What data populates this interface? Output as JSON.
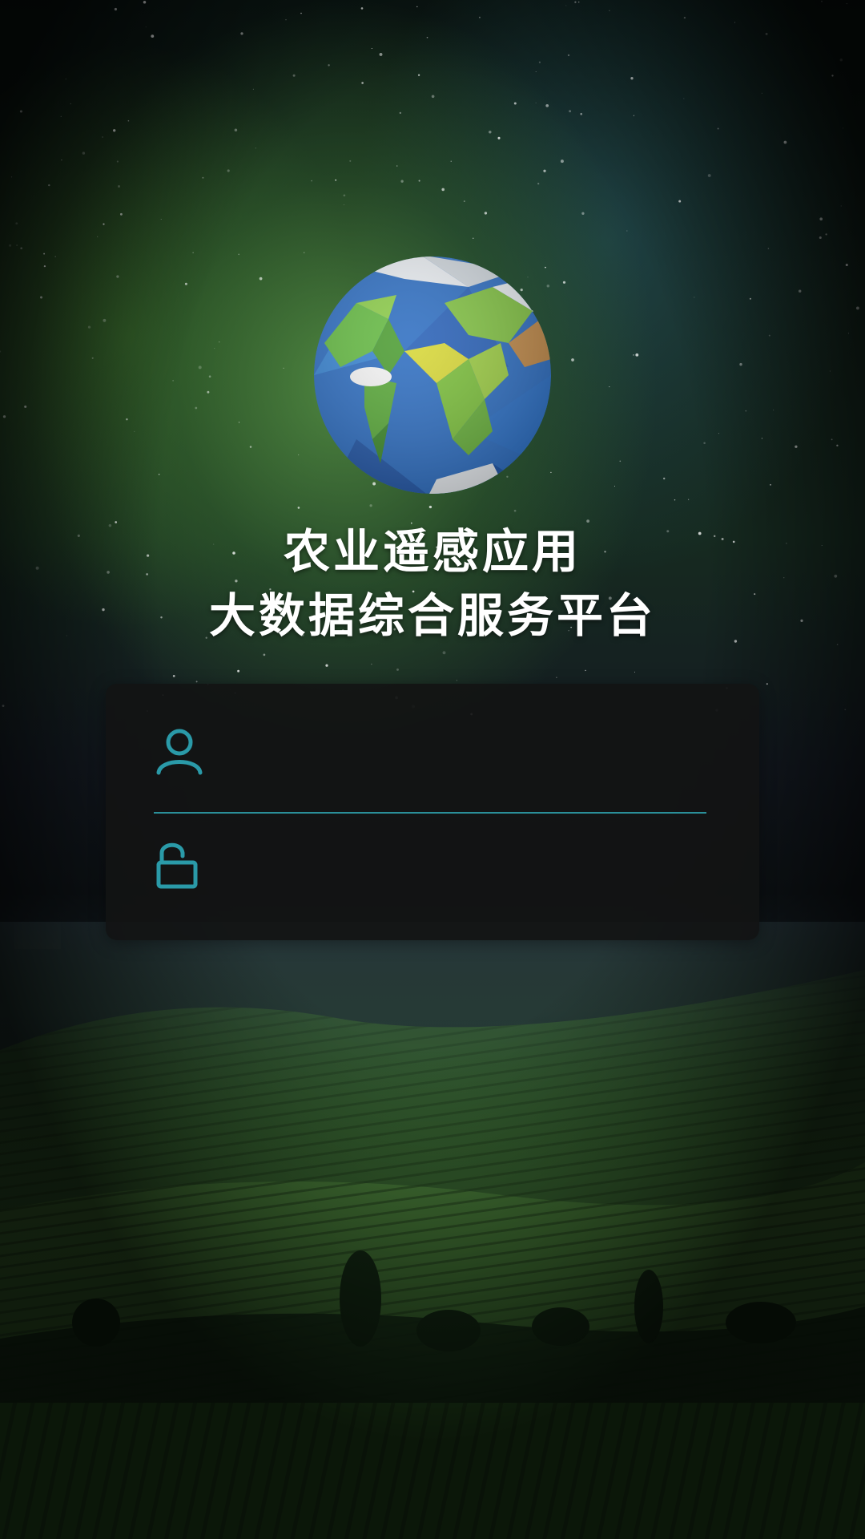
{
  "app": {
    "title_line1": "农业遥感应用",
    "title_line2": "大数据综合服务平台"
  },
  "login": {
    "username": {
      "icon": "user-icon",
      "value": "",
      "placeholder": ""
    },
    "password": {
      "icon": "unlock-icon",
      "value": "",
      "placeholder": ""
    }
  },
  "colors": {
    "accent": "#2a9aa8",
    "title": "#ffffff",
    "card_bg": "#121414"
  },
  "decor": {
    "logo_icon": "globe-icon",
    "background": "starry-sky-and-vineyard-landscape"
  }
}
